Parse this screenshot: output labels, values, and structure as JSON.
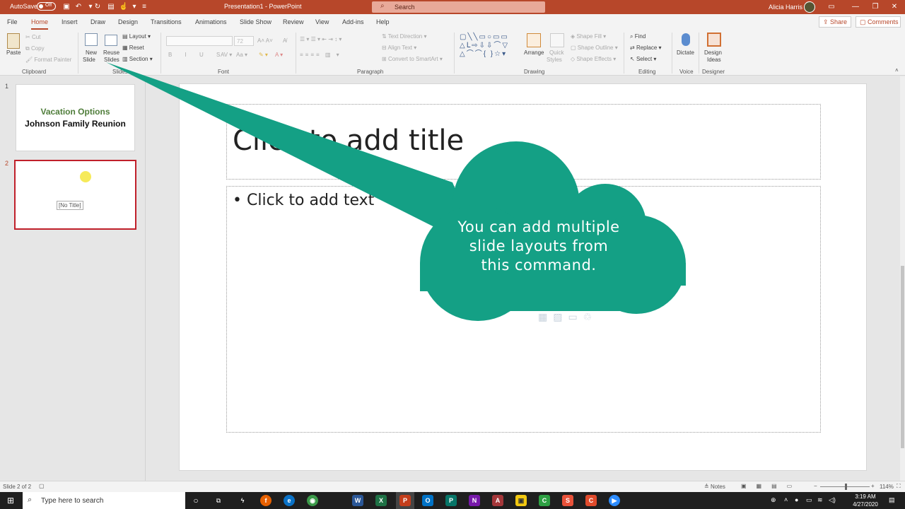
{
  "titlebar": {
    "autosave_label": "AutoSave",
    "autosave_state": "Off",
    "document_title": "Presentation1 - PowerPoint",
    "search_placeholder": "Search",
    "user_name": "Alicia Harris"
  },
  "menu": {
    "tabs": [
      "File",
      "Home",
      "Insert",
      "Draw",
      "Design",
      "Transitions",
      "Animations",
      "Slide Show",
      "Review",
      "View",
      "Add-ins",
      "Help"
    ],
    "active_tab": "Home",
    "share_label": "Share",
    "comments_label": "Comments"
  },
  "ribbon": {
    "clipboard": {
      "paste": "Paste",
      "cut": "Cut",
      "copy": "Copy",
      "format_painter": "Format Painter",
      "group": "Clipboard"
    },
    "slides": {
      "new_slide_1": "New",
      "new_slide_2": "Slide",
      "reuse_1": "Reuse",
      "reuse_2": "Slides",
      "layout": "Layout",
      "reset": "Reset",
      "section": "Section",
      "group": "Slides"
    },
    "font": {
      "size": "72",
      "group": "Font"
    },
    "paragraph": {
      "text_direction": "Text Direction",
      "align_text": "Align Text",
      "convert_smartart": "Convert to SmartArt",
      "group": "Paragraph"
    },
    "drawing": {
      "arrange": "Arrange",
      "quick_1": "Quick",
      "quick_2": "Styles",
      "shape_fill": "Shape Fill",
      "shape_outline": "Shape Outline",
      "shape_effects": "Shape Effects",
      "group": "Drawing"
    },
    "editing": {
      "find": "Find",
      "replace": "Replace",
      "select": "Select",
      "group": "Editing"
    },
    "voice": {
      "dictate": "Dictate",
      "group": "Voice"
    },
    "designer": {
      "ideas_1": "Design",
      "ideas_2": "Ideas",
      "group": "Designer"
    }
  },
  "thumbnails": [
    {
      "number": "1",
      "title": "Vacation Options",
      "subtitle": "Johnson Family Reunion"
    },
    {
      "number": "2",
      "placeholder": "[No Title]"
    }
  ],
  "slide": {
    "title_placeholder": "Click to add title",
    "body_placeholder": "Click to add text"
  },
  "callout": {
    "lines": [
      "You can add multiple",
      "slide layouts from",
      "this command."
    ],
    "color": "#14a085"
  },
  "statusbar": {
    "slide_info": "Slide 2 of 2",
    "notes": "Notes",
    "zoom": "114%",
    "zoom_fraction": 0.52
  },
  "taskbar": {
    "search_placeholder": "Type here to search",
    "time": "3:19 AM",
    "date": "4/27/2020"
  },
  "colors": {
    "accent": "#b7472a",
    "selection_border": "#c0202a",
    "title_green": "#4f7d3a"
  }
}
